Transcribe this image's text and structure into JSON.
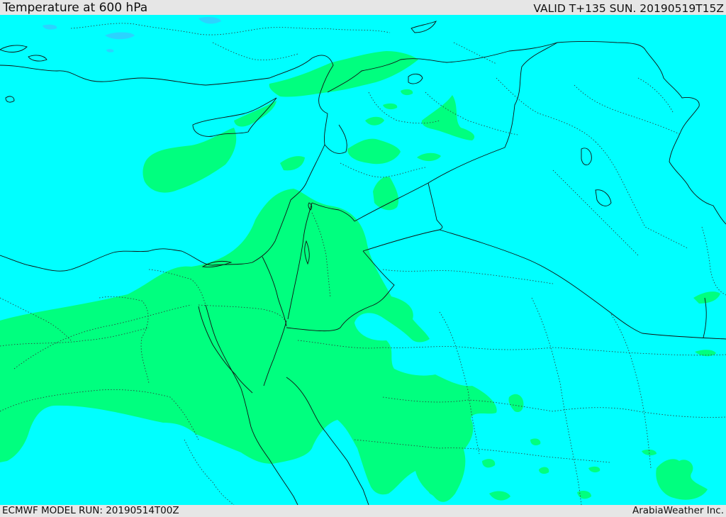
{
  "header": {
    "title": "Temperature at 600 hPa",
    "valid_time": "VALID T+135 SUN. 20190519T15Z"
  },
  "footer": {
    "model_run": "ECMWF MODEL RUN: 20190514T00Z",
    "credit": "ArabiaWeather Inc."
  },
  "map": {
    "colors": {
      "background_field": "#00ffff",
      "warm_field": "#00ff7f",
      "cool_patch": "#33ccff",
      "coastline": "#111111",
      "border": "#111111",
      "admin_border": "#333333"
    },
    "legend": []
  }
}
